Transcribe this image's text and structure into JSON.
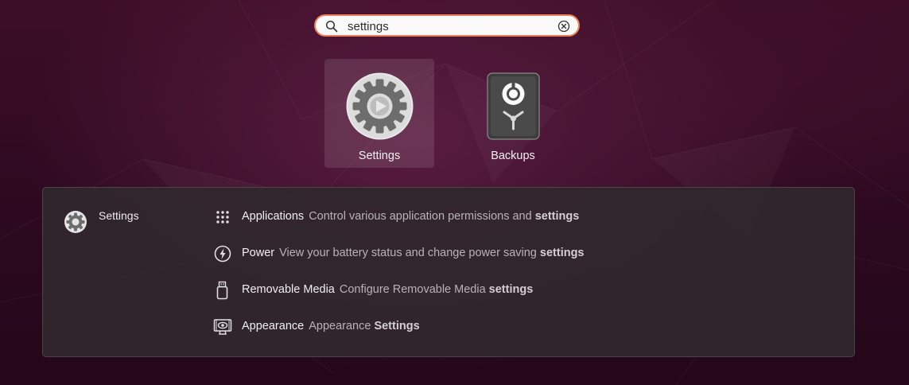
{
  "search": {
    "value": "settings"
  },
  "apps": [
    {
      "label": "Settings",
      "icon": "settings-gear-icon"
    },
    {
      "label": "Backups",
      "icon": "backups-safe-icon"
    }
  ],
  "provider": {
    "label": "Settings",
    "icon": "settings-gear-icon"
  },
  "results": [
    {
      "title": "Applications",
      "desc": "Control various application permissions and",
      "match": "settings",
      "icon": "grid-dots-icon"
    },
    {
      "title": "Power",
      "desc": "View your battery status and change power saving",
      "match": "settings",
      "icon": "power-bolt-icon"
    },
    {
      "title": "Removable Media",
      "desc": "Configure Removable Media",
      "match": "settings",
      "icon": "usb-drive-icon"
    },
    {
      "title": "Appearance",
      "desc": "Appearance",
      "match": "Settings",
      "icon": "appearance-display-icon"
    }
  ],
  "colors": {
    "accent": "#e9825a",
    "panel": "#30282c",
    "background": "#2c0920"
  }
}
